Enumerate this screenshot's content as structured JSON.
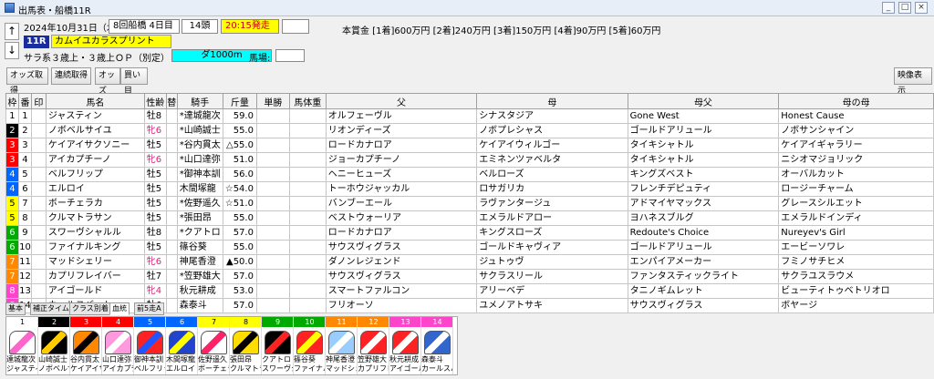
{
  "window": {
    "title": "出馬表・船橋11R",
    "min": "_",
    "max": "□",
    "close": "×"
  },
  "race": {
    "date": "2024年10月31日（木）",
    "meeting": "8回船橋 4日目",
    "heads": "14頭",
    "post_time": "20:15発走",
    "race_no": "11R",
    "race_name": "カムイユカラスプリント",
    "conditions": "サラ系３歳上・３歳上ＯＰ（別定）",
    "course": "ダ1000m",
    "baba_label": "馬場:",
    "prize": "本賞金 [1着]600万円 [2着]240万円 [3着]150万円 [4着]90万円 [5着]60万円",
    "up_arrow": "↑",
    "down_arrow": "↓"
  },
  "toolbar": {
    "odds_get": "オッズ取得",
    "renzoku_get": "連続取得",
    "odds": "オッズ",
    "buy": "買い目",
    "video": "映像表示"
  },
  "columns": [
    "枠",
    "番",
    "印",
    "馬名",
    "性齢",
    "替",
    "騎手",
    "斤量",
    "単勝",
    "馬体重",
    "父",
    "母",
    "母父",
    "母の母"
  ],
  "runners": [
    {
      "waku": "1",
      "ban": "1",
      "name": "ジャスティン",
      "sexage": "牡8",
      "kae": "",
      "jockey": "*達城龍次",
      "weight": "59.0",
      "sire": "オルフェーヴル",
      "dam": "シナスタジア",
      "bms": "Gone West",
      "damdam": "Honest Cause"
    },
    {
      "waku": "2",
      "ban": "2",
      "name": "ノボベルサイユ",
      "sexage": "牝6",
      "kae": "",
      "jockey": "*山崎誠士",
      "weight": "55.0",
      "sire": "リオンディーズ",
      "dam": "ノボプレシャス",
      "bms": "ゴールドアリュール",
      "damdam": "ノボサンシャイン"
    },
    {
      "waku": "3",
      "ban": "3",
      "name": "ケイアイサクソニー",
      "sexage": "牡5",
      "kae": "",
      "jockey": "*谷内貫太",
      "weight": "△55.0",
      "sire": "ロードカナロア",
      "dam": "ケイアイウィルゴー",
      "bms": "タイキシャトル",
      "damdam": "ケイアイギャラリー"
    },
    {
      "waku": "3",
      "ban": "4",
      "name": "アイカプチーノ",
      "sexage": "牝6",
      "kae": "",
      "jockey": "*山口達弥",
      "weight": "51.0",
      "sire": "ジョーカプチーノ",
      "dam": "エミネンツァベルタ",
      "bms": "タイキシャトル",
      "damdam": "ニシオマジョリック"
    },
    {
      "waku": "4",
      "ban": "5",
      "name": "ベルフリップ",
      "sexage": "牡5",
      "kae": "",
      "jockey": "*御神本訓",
      "weight": "56.0",
      "sire": "ヘニーヒューズ",
      "dam": "ベルローズ",
      "bms": "キングズベスト",
      "damdam": "オーバルカット"
    },
    {
      "waku": "4",
      "ban": "6",
      "name": "エルロイ",
      "sexage": "牡5",
      "kae": "",
      "jockey": "木間塚龍",
      "weight": "☆54.0",
      "sire": "トーホウジャッカル",
      "dam": "ロサガリカ",
      "bms": "フレンチデピュティ",
      "damdam": "ロージーチャーム"
    },
    {
      "waku": "5",
      "ban": "7",
      "name": "ボーチェラカ",
      "sexage": "牡5",
      "kae": "",
      "jockey": "*佐野遥久",
      "weight": "☆51.0",
      "sire": "バンブーエール",
      "dam": "ラヴァンタージュ",
      "bms": "アドマイヤマックス",
      "damdam": "グレースシルエット"
    },
    {
      "waku": "5",
      "ban": "8",
      "name": "クルマトラサン",
      "sexage": "牡5",
      "kae": "",
      "jockey": "*張田昂",
      "weight": "55.0",
      "sire": "ベストウォーリア",
      "dam": "エメラルドアロー",
      "bms": "ヨハネスブルグ",
      "damdam": "エメラルドインディ"
    },
    {
      "waku": "6",
      "ban": "9",
      "name": "スワーヴシャルル",
      "sexage": "牡8",
      "kae": "",
      "jockey": "*クアトロ",
      "weight": "57.0",
      "sire": "ロードカナロア",
      "dam": "キングスローズ",
      "bms": "Redoute's Choice",
      "damdam": "Nureyev's Girl"
    },
    {
      "waku": "6",
      "ban": "10",
      "name": "ファイナルキング",
      "sexage": "牡5",
      "kae": "",
      "jockey": "篠谷葵",
      "weight": "55.0",
      "sire": "サウスヴィグラス",
      "dam": "ゴールドキャヴィア",
      "bms": "ゴールドアリュール",
      "damdam": "エービーソワレ"
    },
    {
      "waku": "7",
      "ban": "11",
      "name": "マッドシェリー",
      "sexage": "牝6",
      "kae": "",
      "jockey": "神尾香澄",
      "weight": "▲50.0",
      "sire": "ダノンレジェンド",
      "dam": "ジュトゥヴ",
      "bms": "エンパイアメーカー",
      "damdam": "フミノサチヒメ"
    },
    {
      "waku": "7",
      "ban": "12",
      "name": "カプリフレイバー",
      "sexage": "牡7",
      "kae": "",
      "jockey": "*笠野雄大",
      "weight": "57.0",
      "sire": "サウスヴィグラス",
      "dam": "サクラスリール",
      "bms": "ファンタスティックライト",
      "damdam": "サクラユスラウメ"
    },
    {
      "waku": "8",
      "ban": "13",
      "name": "アイゴールド",
      "sexage": "牝4",
      "kae": "",
      "jockey": "秋元耕成",
      "weight": "53.0",
      "sire": "スマートファルコン",
      "dam": "アリーベデ",
      "bms": "タニノギムレット",
      "damdam": "ビューティトゥベトリオロ"
    },
    {
      "waku": "8",
      "ban": "14",
      "name": "カールスバート",
      "sexage": "牡6",
      "kae": "",
      "jockey": "森泰斗",
      "weight": "57.0",
      "sire": "フリオーソ",
      "dam": "ユメノアトサキ",
      "bms": "サウスヴィグラス",
      "damdam": "ボヤージ"
    }
  ],
  "tabs": [
    "基本",
    "補正タイム",
    "クラス別着",
    "血統",
    "前5走A"
  ],
  "silks": [
    {
      "num": "1",
      "jockey": "達城龍次",
      "horse": "ジャスティン",
      "numbg": "#ffffff",
      "numfg": "#000000",
      "c1": "#ffffff",
      "c2": "#ff66cc"
    },
    {
      "num": "2",
      "jockey": "山崎誠士",
      "horse": "ノボベルサイユ",
      "numbg": "#000000",
      "numfg": "#ffffff",
      "c1": "#000000",
      "c2": "#ffcc00"
    },
    {
      "num": "3",
      "jockey": "谷内貫太",
      "horse": "ケイアイサクソニー",
      "numbg": "#ff0000",
      "numfg": "#ffffff",
      "c1": "#ff8800",
      "c2": "#000000"
    },
    {
      "num": "4",
      "jockey": "山口達弥",
      "horse": "アイカプチーノ",
      "numbg": "#ff0000",
      "numfg": "#ffffff",
      "c1": "#ff99dd",
      "c2": "#ffffff"
    },
    {
      "num": "5",
      "jockey": "御神本訓",
      "horse": "ベルフリップ",
      "numbg": "#0066ff",
      "numfg": "#ffffff",
      "c1": "#ff2222",
      "c2": "#2255ff"
    },
    {
      "num": "6",
      "jockey": "木間塚龍",
      "horse": "エルロイ",
      "numbg": "#0066ff",
      "numfg": "#ffffff",
      "c1": "#2244cc",
      "c2": "#ffff00"
    },
    {
      "num": "7",
      "jockey": "佐野遥久",
      "horse": "ボーチェラカ",
      "numbg": "#ffff00",
      "numfg": "#000000",
      "c1": "#ffffff",
      "c2": "#ff2266"
    },
    {
      "num": "8",
      "jockey": "張田昂",
      "horse": "クルマトラサン",
      "numbg": "#ffff00",
      "numfg": "#000000",
      "c1": "#ffdd00",
      "c2": "#000000"
    },
    {
      "num": "9",
      "jockey": "クアトロ",
      "horse": "スワーヴシャルル",
      "numbg": "#00aa00",
      "numfg": "#ffffff",
      "c1": "#000000",
      "c2": "#ff2222"
    },
    {
      "num": "10",
      "jockey": "篠谷葵",
      "horse": "ファイナルキング",
      "numbg": "#00aa00",
      "numfg": "#ffffff",
      "c1": "#ff2222",
      "c2": "#ffff00"
    },
    {
      "num": "11",
      "jockey": "神尾香澄",
      "horse": "マッドシェリー",
      "numbg": "#ff8800",
      "numfg": "#ffffff",
      "c1": "#99ccff",
      "c2": "#ffffff"
    },
    {
      "num": "12",
      "jockey": "笠野雄大",
      "horse": "カプリフレイバー",
      "numbg": "#ff8800",
      "numfg": "#ffffff",
      "c1": "#ff2222",
      "c2": "#ffffff"
    },
    {
      "num": "13",
      "jockey": "秋元耕成",
      "horse": "アイゴールド",
      "numbg": "#ff44cc",
      "numfg": "#ffffff",
      "c1": "#ff2222",
      "c2": "#ffffff"
    },
    {
      "num": "14",
      "jockey": "森泰斗",
      "horse": "カールスバート",
      "numbg": "#ff44cc",
      "numfg": "#ffffff",
      "c1": "#3366cc",
      "c2": "#ffffff"
    }
  ],
  "colors": {
    "waku": {
      "1": "#ffffff",
      "2": "#000000",
      "3": "#ff0000",
      "4": "#0066ff",
      "5": "#ffff00",
      "6": "#00aa00",
      "7": "#ff8800",
      "8": "#ff44cc"
    },
    "waku_text": {
      "1": "#000000",
      "2": "#ffffff",
      "3": "#ffffff",
      "4": "#ffffff",
      "5": "#000000",
      "6": "#ffffff",
      "7": "#ffffff",
      "8": "#ffffff"
    },
    "female_sex": "#e0207a"
  }
}
